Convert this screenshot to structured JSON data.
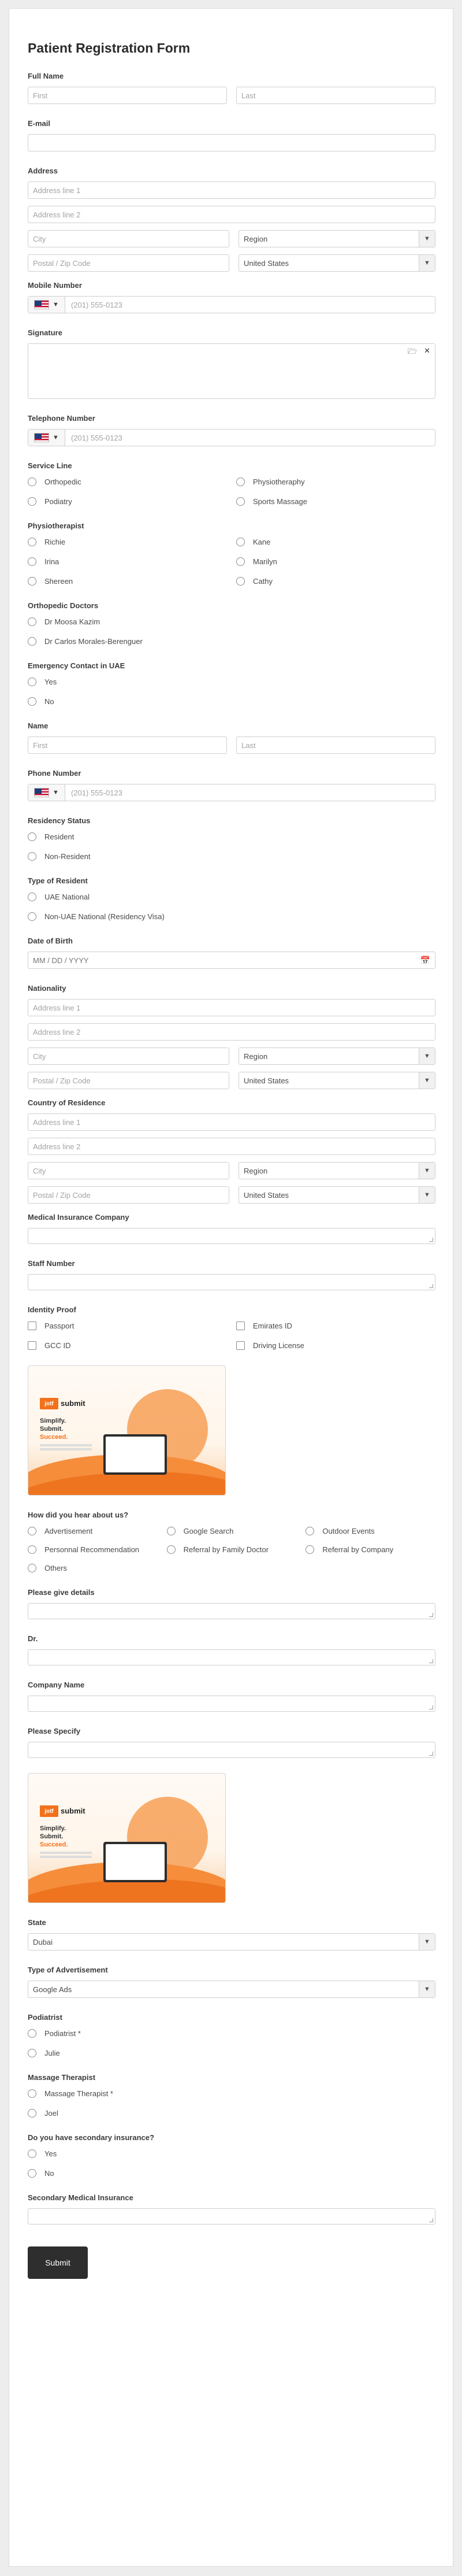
{
  "title": "Patient Registration Form",
  "full_name": {
    "label": "Full Name",
    "first": "First",
    "last": "Last"
  },
  "email": {
    "label": "E-mail"
  },
  "address": {
    "label": "Address",
    "line1": "Address line 1",
    "line2": "Address line 2",
    "city": "City",
    "region": "Region",
    "postal": "Postal / Zip Code",
    "country": "United States"
  },
  "mobile": {
    "label": "Mobile Number",
    "placeholder": "(201) 555-0123"
  },
  "signature": {
    "label": "Signature"
  },
  "telephone": {
    "label": "Telephone Number",
    "placeholder": "(201) 555-0123"
  },
  "service_line": {
    "label": "Service Line",
    "options": [
      "Orthopedic",
      "Physiotheraphy",
      "Podiatry",
      "Sports Massage"
    ]
  },
  "physiotherapist": {
    "label": "Physiotherapist",
    "options": [
      "Richie",
      "Kane",
      "Irina",
      "Marilyn",
      "Shereen",
      "Cathy"
    ]
  },
  "orthopedic": {
    "label": "Orthopedic Doctors",
    "options": [
      "Dr Moosa Kazim",
      "Dr Carlos Morales-Berenguer"
    ]
  },
  "emergency": {
    "label": "Emergency Contact in UAE",
    "options": [
      "Yes",
      "No"
    ]
  },
  "name": {
    "label": "Name",
    "first": "First",
    "last": "Last"
  },
  "phone": {
    "label": "Phone Number",
    "placeholder": "(201) 555-0123"
  },
  "residency": {
    "label": "Residency Status",
    "options": [
      "Resident",
      "Non-Resident"
    ]
  },
  "resident_type": {
    "label": "Type of Resident",
    "options": [
      "UAE National",
      "Non-UAE National (Residency Visa)"
    ]
  },
  "dob": {
    "label": "Date of Birth",
    "placeholder": "MM / DD / YYYY"
  },
  "nationality": {
    "label": "Nationality",
    "line1": "Address line 1",
    "line2": "Address line 2",
    "city": "City",
    "region": "Region",
    "postal": "Postal / Zip Code",
    "country": "United States"
  },
  "country_res": {
    "label": "Country of Residence",
    "line1": "Address line 1",
    "line2": "Address line 2",
    "city": "City",
    "region": "Region",
    "postal": "Postal / Zip Code",
    "country": "United States"
  },
  "insurance": {
    "label": "Medical Insurance Company"
  },
  "staff": {
    "label": "Staff Number"
  },
  "identity": {
    "label": "Identity Proof",
    "options": [
      "Passport",
      "Emirates ID",
      "GCC ID",
      "Driving License"
    ]
  },
  "promo": {
    "badge": "jotf",
    "brand": "submit",
    "tag1": "Simplify.",
    "tag2": "Submit.",
    "tag3": "Succeed."
  },
  "hear": {
    "label": "How did you hear about us?",
    "options": [
      "Advertisement",
      "Google Search",
      "Outdoor Events",
      "Personnal Recommendation",
      "Referral by Family Doctor",
      "Referral by Company",
      "Others"
    ]
  },
  "details": {
    "label": "Please give details"
  },
  "dr": {
    "label": "Dr."
  },
  "company": {
    "label": "Company Name"
  },
  "specify": {
    "label": "Please Specify"
  },
  "state": {
    "label": "State",
    "value": "Dubai"
  },
  "ad_type": {
    "label": "Type of Advertisement",
    "value": "Google Ads"
  },
  "podiatrist": {
    "label": "Podiatrist",
    "options": [
      "Podiatrist *",
      "Julie"
    ]
  },
  "massage": {
    "label": "Massage Therapist",
    "options": [
      "Massage Therapist *",
      "Joel"
    ]
  },
  "secondary": {
    "label": "Do you have secondary insurance?",
    "options": [
      "Yes",
      "No"
    ]
  },
  "secondary_company": {
    "label": "Secondary Medical Insurance"
  },
  "submit": "Submit"
}
